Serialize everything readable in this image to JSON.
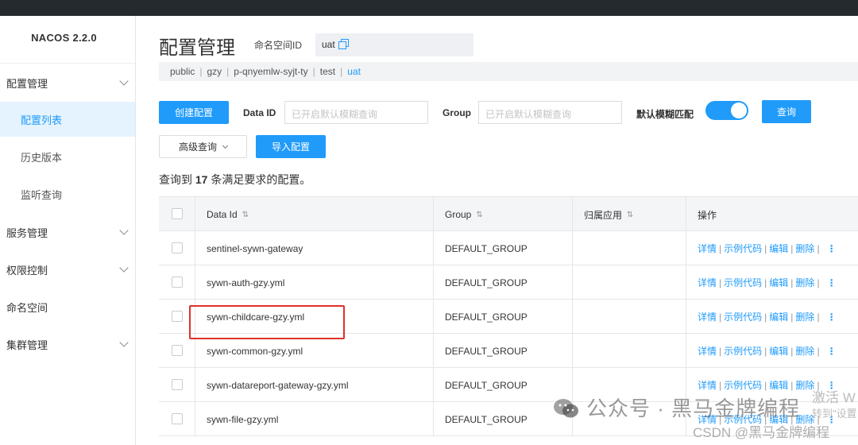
{
  "app": {
    "logo": "NACOS 2.2.0"
  },
  "sidebar": {
    "items": [
      {
        "label": "配置管理",
        "expandable": true
      },
      {
        "label": "配置列表",
        "sub": true,
        "active": true
      },
      {
        "label": "历史版本",
        "sub": true
      },
      {
        "label": "监听查询",
        "sub": true
      },
      {
        "label": "服务管理",
        "expandable": true
      },
      {
        "label": "权限控制",
        "expandable": true
      },
      {
        "label": "命名空间"
      },
      {
        "label": "集群管理",
        "expandable": true
      }
    ]
  },
  "header": {
    "title": "配置管理",
    "namespace_label": "命名空间ID",
    "namespace_value": "uat"
  },
  "namespaces": [
    "public",
    "gzy",
    "p-qnyemlw-syjt-ty",
    "test",
    "uat"
  ],
  "filters": {
    "create_button": "创建配置",
    "data_id_label": "Data ID",
    "data_id_placeholder": "已开启默认模糊查询",
    "group_label": "Group",
    "group_placeholder": "已开启默认模糊查询",
    "fuzzy_label": "默认模糊匹配",
    "query_button": "查询",
    "advanced_button": "高级查询",
    "import_button": "导入配置"
  },
  "result": {
    "prefix": "查询到",
    "count": "17",
    "suffix": "条满足要求的配置。"
  },
  "table": {
    "columns": [
      "Data Id",
      "Group",
      "归属应用",
      "操作"
    ],
    "rows": [
      {
        "data_id": "sentinel-sywn-gateway",
        "group": "DEFAULT_GROUP",
        "app": ""
      },
      {
        "data_id": "sywn-auth-gzy.yml",
        "group": "DEFAULT_GROUP",
        "app": ""
      },
      {
        "data_id": "sywn-childcare-gzy.yml",
        "group": "DEFAULT_GROUP",
        "app": ""
      },
      {
        "data_id": "sywn-common-gzy.yml",
        "group": "DEFAULT_GROUP",
        "app": ""
      },
      {
        "data_id": "sywn-datareport-gateway-gzy.yml",
        "group": "DEFAULT_GROUP",
        "app": ""
      },
      {
        "data_id": "sywn-file-gzy.yml",
        "group": "DEFAULT_GROUP",
        "app": ""
      }
    ],
    "actions": [
      "详情",
      "示例代码",
      "编辑",
      "删除"
    ]
  },
  "overlay": {
    "watermark": "公众号 · 黑马金牌编程",
    "csdn": "CSDN @黑马金牌编程",
    "activate": "激活 W",
    "activate_sub": "转到\"设置"
  },
  "colors": {
    "accent": "#209bfa",
    "highlight": "#e0302a",
    "topbar": "#252a2f"
  }
}
